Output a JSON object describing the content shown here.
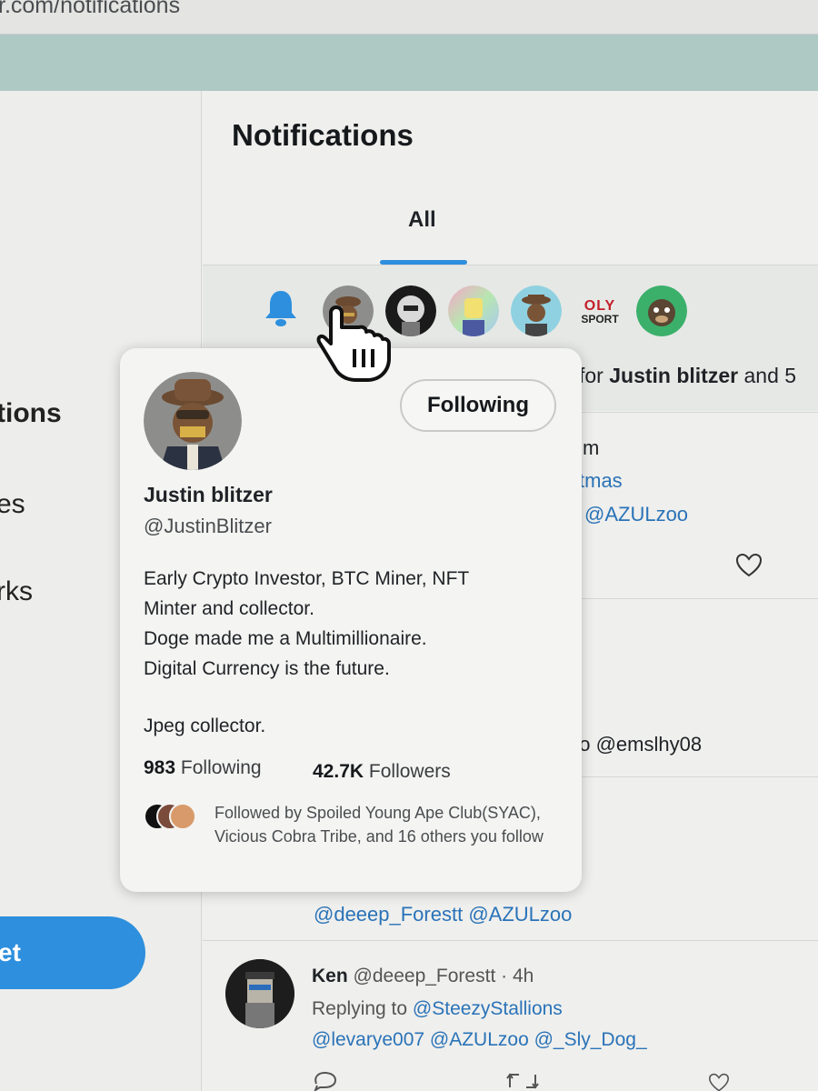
{
  "browser": {
    "url": "r.com/notifications"
  },
  "sidebar": {
    "items": [
      "tions",
      "es",
      "rks"
    ],
    "tweet_button": "et"
  },
  "main": {
    "title": "Notifications",
    "tab": "All",
    "row1": {
      "text_prefix": "for ",
      "text_name": "Justin blitzer",
      "text_suffix": " and 5"
    },
    "row2": {
      "line1": "m",
      "line2": "tmas",
      "line3": "@AZULzoo"
    },
    "row3": {
      "line1": "oo @emslhy08"
    },
    "row4": {
      "line1": "@deeep_Forestt @AZULzoo"
    },
    "row5": {
      "name": "Ken",
      "handle": "@deeep_Forestt",
      "time": "· 4h",
      "replying_label": "Replying to",
      "replying_to": "@SteezyStallions",
      "mentions": "@levarye007 @AZULzoo @_Sly_Dog_"
    },
    "oly_logo": {
      "top": "OLY",
      "bottom": "SPORT"
    }
  },
  "hover_card": {
    "follow_button": "Following",
    "name": "Justin blitzer",
    "handle": "@JustinBlitzer",
    "bio_lines": [
      "Early Crypto Investor, BTC Miner, NFT",
      "Minter and collector.",
      "Doge made me a Multimillionaire.",
      "Digital Currency is the future."
    ],
    "bio_extra": "Jpeg collector.",
    "following_count": "983",
    "following_label": "Following",
    "followers_count": "42.7K",
    "followers_label": "Followers",
    "followed_by": "Followed by Spoiled Young Ape Club(SYAC), Vicious Cobra Tribe, and 16 others you follow"
  },
  "colors": {
    "accent": "#2d8fdd",
    "link": "#2a73b8",
    "teal_band": "#aec8c4"
  },
  "icons": [
    "bell-icon",
    "heart-icon",
    "reply-icon",
    "retweet-icon",
    "hand-cursor-icon"
  ]
}
